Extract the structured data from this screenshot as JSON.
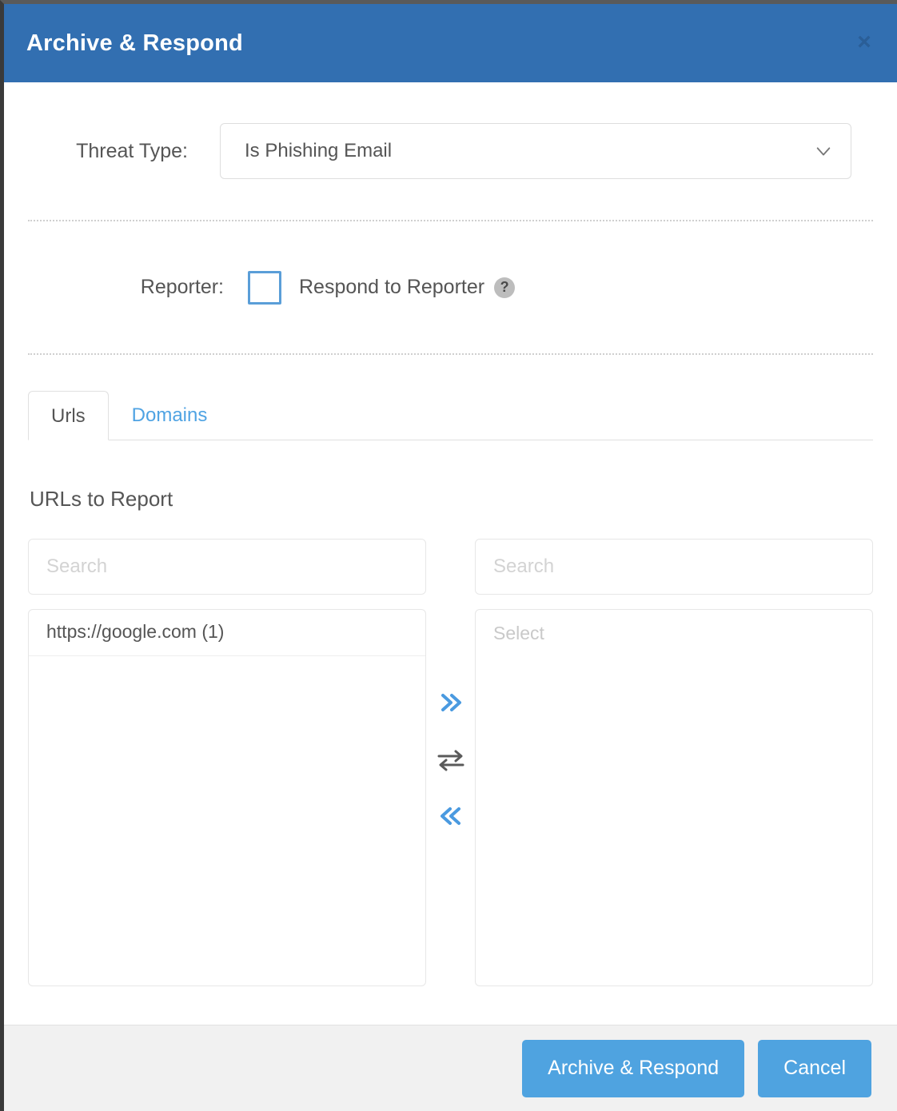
{
  "dialog": {
    "title": "Archive & Respond",
    "close_label": "×"
  },
  "threat": {
    "label": "Threat Type:",
    "value": "Is Phishing Email",
    "caret_icon": "chevron-down-icon"
  },
  "reporter": {
    "label": "Reporter:",
    "checkbox_label": "Respond to Reporter",
    "checked": false,
    "help_icon": "?"
  },
  "tabs": [
    {
      "label": "Urls",
      "active": true
    },
    {
      "label": "Domains",
      "active": false
    }
  ],
  "section": {
    "title": "URLs to Report"
  },
  "available": {
    "search_placeholder": "Search",
    "search_value": "",
    "items": [
      "https://google.com (1)"
    ]
  },
  "selected": {
    "search_placeholder": "Search",
    "search_value": "",
    "empty_text": "Select",
    "items": []
  },
  "transfer": {
    "move_all_right_icon": "double-chevron-right-icon",
    "swap_icon": "swap-arrows-icon",
    "move_all_left_icon": "double-chevron-left-icon"
  },
  "footer": {
    "primary_label": "Archive & Respond",
    "secondary_label": "Cancel"
  },
  "colors": {
    "header_blue": "#326fb1",
    "button_blue": "#4fa3e0",
    "link_blue": "#4fa3e3",
    "checkbox_blue": "#5a9ed8",
    "footer_gray": "#f1f1f1",
    "text_gray": "#555555"
  }
}
